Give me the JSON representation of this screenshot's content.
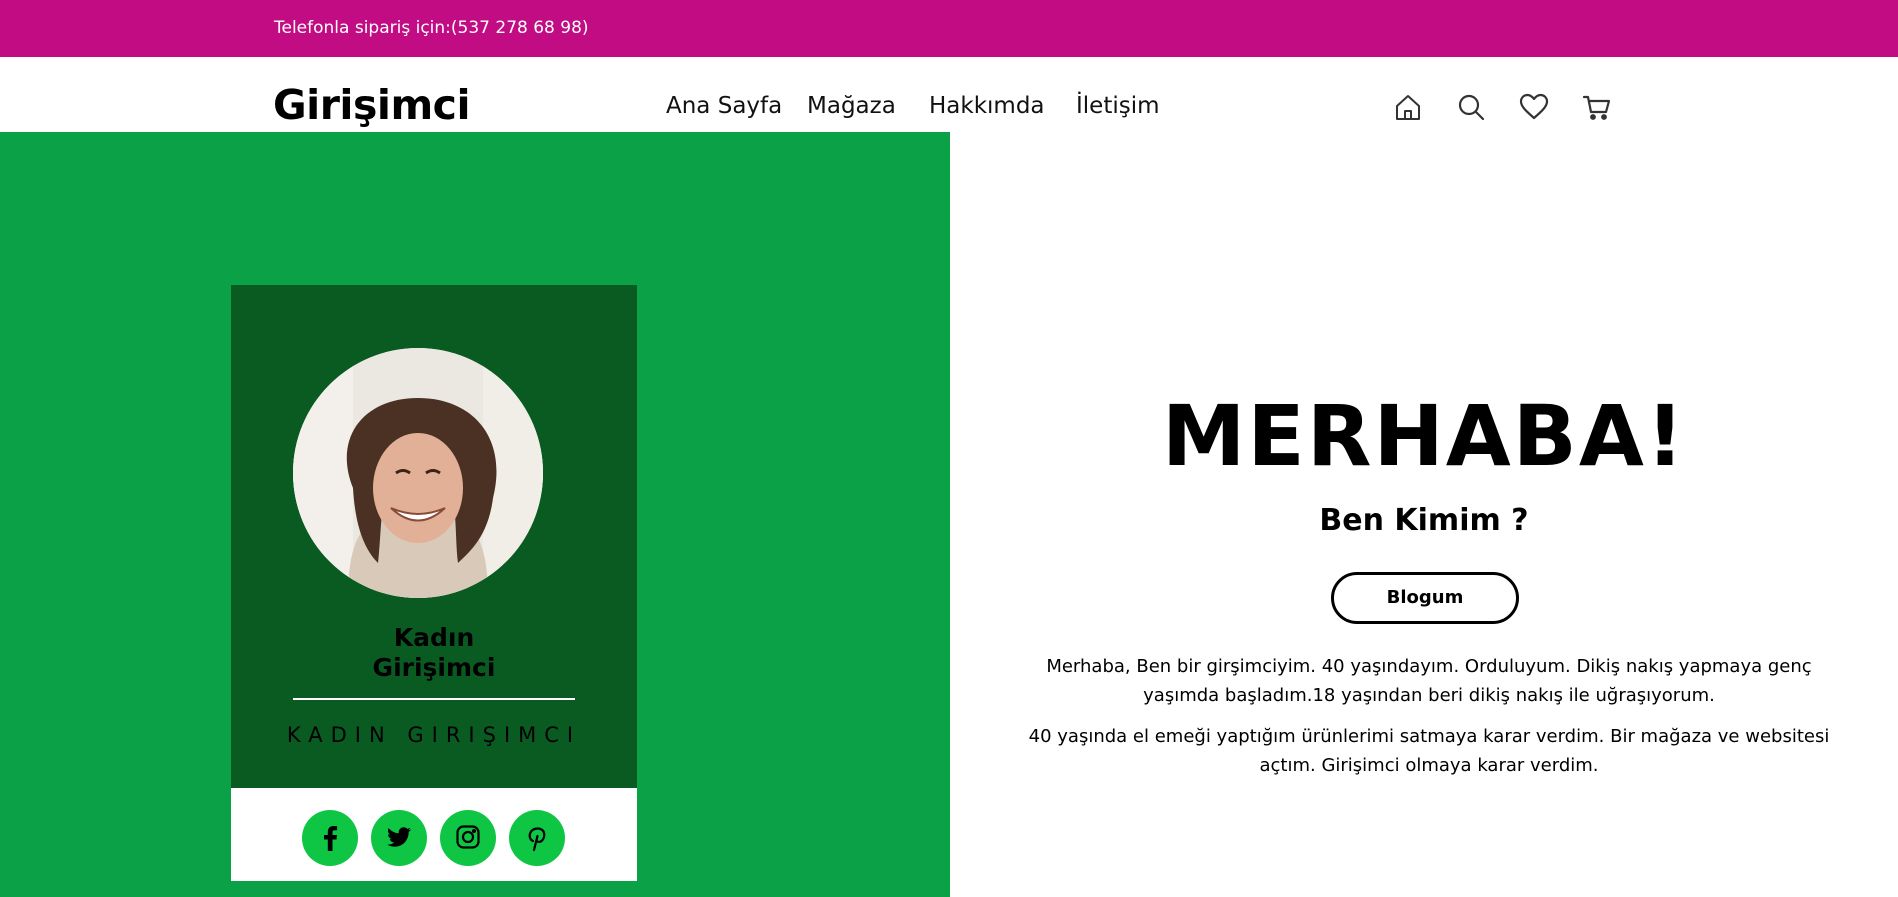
{
  "topbar": {
    "text": "Telefonla sipariş için:(537 278 68 98)"
  },
  "header": {
    "logo": "Girişimci",
    "nav": [
      "Ana Sayfa",
      "Mağaza",
      "Hakkımda",
      "İletişim"
    ],
    "icons": [
      "home-icon",
      "search-icon",
      "heart-icon",
      "cart-icon"
    ]
  },
  "card": {
    "name_line1": "Kadın",
    "name_line2": "Girişimci",
    "subtitle": "KADIN GIRIŞIMCI",
    "social": [
      "facebook-icon",
      "twitter-icon",
      "instagram-icon",
      "pinterest-icon"
    ]
  },
  "hero": {
    "title": "MERHABA!",
    "subtitle": "Ben Kimim ?",
    "button": "Blogum",
    "paragraph1": "Merhaba, Ben bir girşimciyim. 40 yaşındayım. Orduluyum. Dikiş nakış yapmaya genç yaşımda başladım.18 yaşından beri dikiş nakış ile uğraşıyorum.",
    "paragraph2": "40 yaşında el emeği yaptığım ürünlerimi satmaya karar verdim. Bir mağaza ve websitesi açtım. Girişimci olmaya karar verdim."
  },
  "colors": {
    "topbar": "#c20c84",
    "green_panel": "#0ba146",
    "card_dark": "#0a5b22",
    "social_green": "#0fc544"
  }
}
